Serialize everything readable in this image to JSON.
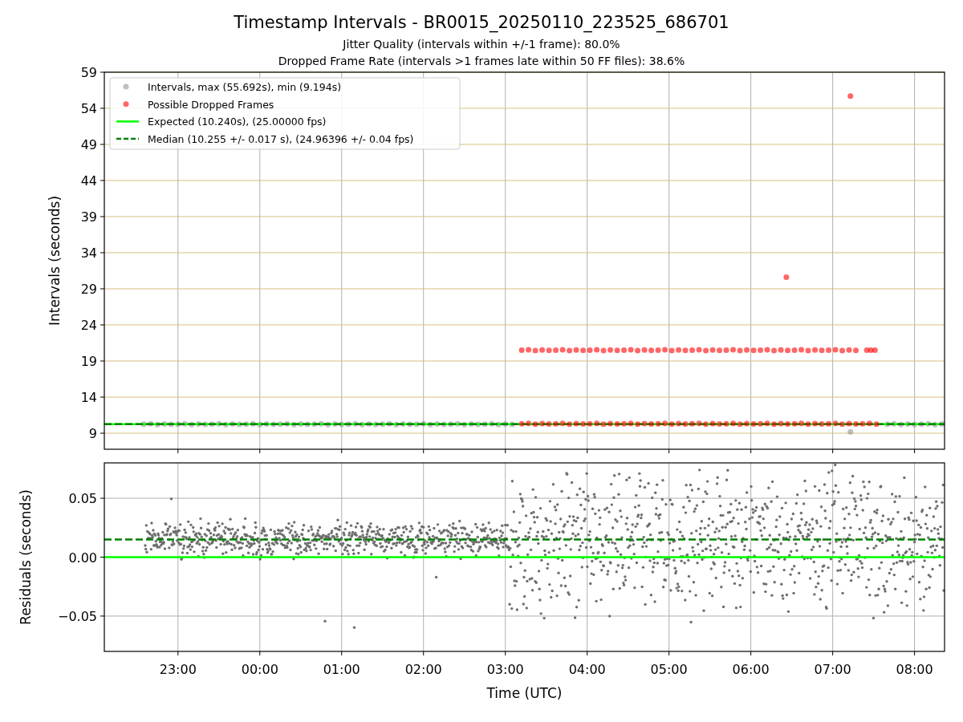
{
  "figure": {
    "title": "Timestamp Intervals - BR0015_20250110_223525_686701",
    "subtitles": [
      "Jitter Quality (intervals within +/-1 frame): 80.0%",
      "Dropped Frame Rate (intervals >1 frames late within 50 FF files): 38.6%"
    ]
  },
  "interval_plot": {
    "chart_data": {
      "type": "scatter",
      "grid": true,
      "legend": true,
      "ylabel": "Intervals (seconds)",
      "xlim": [
        "2025-01-10T22:06",
        "2025-01-11T08:22"
      ],
      "ylim": [
        6.78,
        59
      ],
      "yticks": [
        {
          "value": 59,
          "label": "59"
        },
        {
          "value": 54,
          "label": "54"
        },
        {
          "value": 49,
          "label": "49"
        },
        {
          "value": 44,
          "label": "44"
        },
        {
          "value": 39,
          "label": "39"
        },
        {
          "value": 34,
          "label": "34"
        },
        {
          "value": 29,
          "label": "29"
        },
        {
          "value": 24,
          "label": "24"
        },
        {
          "value": 19,
          "label": "19"
        },
        {
          "value": 14,
          "label": "14"
        },
        {
          "value": 9,
          "label": "9"
        }
      ],
      "series": [
        {
          "name": "Intervals, max (55.692s), min (9.194s)",
          "type": "scatter",
          "color": "#808080",
          "x": [
            "2025-01-10T22:35",
            "2025-01-10T22:40",
            "2025-01-10T22:45",
            "2025-01-10T22:50",
            "2025-01-10T22:55",
            "2025-01-10T23:00",
            "2025-01-10T23:05",
            "2025-01-10T23:10",
            "2025-01-10T23:15",
            "2025-01-10T23:20",
            "2025-01-10T23:25",
            "2025-01-10T23:30",
            "2025-01-10T23:35",
            "2025-01-10T23:40",
            "2025-01-10T23:45",
            "2025-01-10T23:50",
            "2025-01-10T23:55",
            "2025-01-11T00:00",
            "2025-01-11T00:05",
            "2025-01-11T00:10",
            "2025-01-11T00:15",
            "2025-01-11T00:20",
            "2025-01-11T00:25",
            "2025-01-11T00:30",
            "2025-01-11T00:35",
            "2025-01-11T00:40",
            "2025-01-11T00:45",
            "2025-01-11T00:50",
            "2025-01-11T00:55",
            "2025-01-11T01:00",
            "2025-01-11T01:05",
            "2025-01-11T01:10",
            "2025-01-11T01:15",
            "2025-01-11T01:20",
            "2025-01-11T01:25",
            "2025-01-11T01:30",
            "2025-01-11T01:35",
            "2025-01-11T01:40",
            "2025-01-11T01:45",
            "2025-01-11T01:50",
            "2025-01-11T01:55",
            "2025-01-11T02:00",
            "2025-01-11T02:05",
            "2025-01-11T02:10",
            "2025-01-11T02:15",
            "2025-01-11T02:20",
            "2025-01-11T02:25",
            "2025-01-11T02:30",
            "2025-01-11T02:35",
            "2025-01-11T02:40",
            "2025-01-11T02:45",
            "2025-01-11T02:50",
            "2025-01-11T02:55",
            "2025-01-11T03:00",
            "2025-01-11T03:05",
            "2025-01-11T07:40",
            "2025-01-11T07:45",
            "2025-01-11T07:50",
            "2025-01-11T07:55",
            "2025-01-11T08:00",
            "2025-01-11T08:05",
            "2025-01-11T08:10",
            "2025-01-11T08:15",
            "2025-01-11T08:20",
            "2025-01-11T07:13"
          ],
          "values": [
            10.25,
            10.31,
            10.2,
            10.28,
            10.22,
            10.25,
            10.31,
            10.2,
            10.28,
            10.22,
            10.25,
            10.31,
            10.2,
            10.28,
            10.22,
            10.25,
            10.31,
            10.2,
            10.28,
            10.22,
            10.25,
            10.31,
            10.2,
            10.28,
            10.22,
            10.25,
            10.31,
            10.2,
            10.28,
            10.22,
            10.25,
            10.31,
            10.2,
            10.28,
            10.22,
            10.25,
            10.31,
            10.2,
            10.28,
            10.22,
            10.25,
            10.31,
            10.2,
            10.28,
            10.22,
            10.25,
            10.31,
            10.2,
            10.28,
            10.22,
            10.25,
            10.31,
            10.2,
            10.28,
            10.22,
            10.25,
            10.31,
            10.2,
            10.28,
            10.22,
            10.25,
            10.31,
            10.2,
            10.28,
            9.194
          ]
        },
        {
          "name": "Possible Dropped Frames",
          "type": "scatter",
          "color": "#ff0000",
          "x": [
            "2025-01-11T03:12",
            "2025-01-11T03:17",
            "2025-01-11T03:22",
            "2025-01-11T03:27",
            "2025-01-11T03:32",
            "2025-01-11T03:37",
            "2025-01-11T03:42",
            "2025-01-11T03:47",
            "2025-01-11T03:52",
            "2025-01-11T03:57",
            "2025-01-11T04:02",
            "2025-01-11T04:07",
            "2025-01-11T04:12",
            "2025-01-11T04:17",
            "2025-01-11T04:22",
            "2025-01-11T04:27",
            "2025-01-11T04:32",
            "2025-01-11T04:37",
            "2025-01-11T04:42",
            "2025-01-11T04:47",
            "2025-01-11T04:52",
            "2025-01-11T04:57",
            "2025-01-11T05:02",
            "2025-01-11T05:07",
            "2025-01-11T05:12",
            "2025-01-11T05:17",
            "2025-01-11T05:22",
            "2025-01-11T05:27",
            "2025-01-11T05:32",
            "2025-01-11T05:37",
            "2025-01-11T05:42",
            "2025-01-11T05:47",
            "2025-01-11T05:52",
            "2025-01-11T05:57",
            "2025-01-11T06:02",
            "2025-01-11T06:07",
            "2025-01-11T06:12",
            "2025-01-11T06:17",
            "2025-01-11T06:22",
            "2025-01-11T06:27",
            "2025-01-11T06:32",
            "2025-01-11T06:37",
            "2025-01-11T06:42",
            "2025-01-11T06:47",
            "2025-01-11T06:52",
            "2025-01-11T06:57",
            "2025-01-11T07:02",
            "2025-01-11T07:07",
            "2025-01-11T07:12",
            "2025-01-11T07:17",
            "2025-01-11T07:22",
            "2025-01-11T07:27",
            "2025-01-11T07:32",
            "2025-01-11T03:12",
            "2025-01-11T03:17",
            "2025-01-11T03:22",
            "2025-01-11T03:27",
            "2025-01-11T03:32",
            "2025-01-11T03:37",
            "2025-01-11T03:42",
            "2025-01-11T03:47",
            "2025-01-11T03:52",
            "2025-01-11T03:57",
            "2025-01-11T04:02",
            "2025-01-11T04:07",
            "2025-01-11T04:12",
            "2025-01-11T04:17",
            "2025-01-11T04:22",
            "2025-01-11T04:27",
            "2025-01-11T04:32",
            "2025-01-11T04:37",
            "2025-01-11T04:42",
            "2025-01-11T04:47",
            "2025-01-11T04:52",
            "2025-01-11T04:57",
            "2025-01-11T05:02",
            "2025-01-11T05:07",
            "2025-01-11T05:12",
            "2025-01-11T05:17",
            "2025-01-11T05:22",
            "2025-01-11T05:27",
            "2025-01-11T05:32",
            "2025-01-11T05:37",
            "2025-01-11T05:42",
            "2025-01-11T05:47",
            "2025-01-11T05:52",
            "2025-01-11T05:57",
            "2025-01-11T06:02",
            "2025-01-11T06:07",
            "2025-01-11T06:12",
            "2025-01-11T06:17",
            "2025-01-11T06:22",
            "2025-01-11T06:27",
            "2025-01-11T06:32",
            "2025-01-11T06:37",
            "2025-01-11T06:42",
            "2025-01-11T06:47",
            "2025-01-11T06:52",
            "2025-01-11T06:57",
            "2025-01-11T07:02",
            "2025-01-11T07:07",
            "2025-01-11T07:12",
            "2025-01-11T07:17",
            "2025-01-11T07:25",
            "2025-01-11T07:28",
            "2025-01-11T07:31",
            "2025-01-11T06:26",
            "2025-01-11T07:13"
          ],
          "values": [
            10.3,
            10.36,
            10.25,
            10.33,
            10.27,
            10.3,
            10.36,
            10.25,
            10.33,
            10.27,
            10.3,
            10.36,
            10.25,
            10.33,
            10.27,
            10.3,
            10.36,
            10.25,
            10.33,
            10.27,
            10.3,
            10.36,
            10.25,
            10.33,
            10.27,
            10.3,
            10.36,
            10.25,
            10.33,
            10.27,
            10.3,
            10.36,
            10.25,
            10.33,
            10.27,
            10.3,
            10.36,
            10.25,
            10.33,
            10.27,
            10.3,
            10.36,
            10.25,
            10.33,
            10.27,
            10.3,
            10.36,
            10.25,
            10.33,
            10.27,
            10.3,
            10.36,
            10.25,
            20.5,
            20.56,
            20.44,
            20.52,
            20.47,
            20.5,
            20.56,
            20.44,
            20.52,
            20.47,
            20.5,
            20.56,
            20.44,
            20.52,
            20.47,
            20.5,
            20.56,
            20.44,
            20.52,
            20.47,
            20.5,
            20.56,
            20.44,
            20.52,
            20.47,
            20.5,
            20.56,
            20.44,
            20.52,
            20.47,
            20.5,
            20.56,
            20.44,
            20.52,
            20.47,
            20.5,
            20.56,
            20.44,
            20.52,
            20.47,
            20.5,
            20.56,
            20.44,
            20.52,
            20.47,
            20.5,
            20.56,
            20.44,
            20.52,
            20.47,
            20.5,
            20.5,
            20.5,
            30.6,
            55.692
          ]
        },
        {
          "name": "Expected (10.240s), (25.00000 fps)",
          "type": "line",
          "color": "#00ff00",
          "x": [
            "2025-01-10T22:06",
            "2025-01-11T08:22"
          ],
          "values": [
            10.24,
            10.24
          ]
        },
        {
          "name": "Median (10.255 +/- 0.017 s), (24.96396 +/- 0.04 fps)",
          "type": "line",
          "line_style": "dashed",
          "color": "#008000",
          "x": [
            "2025-01-10T22:06",
            "2025-01-11T08:22"
          ],
          "values": [
            10.255,
            10.255
          ]
        }
      ]
    }
  },
  "residual_plot": {
    "chart_data": {
      "type": "scatter",
      "grid": true,
      "xlabel": "Time (UTC)",
      "ylabel": "Residuals (seconds)",
      "xlim": [
        "2025-01-10T22:06",
        "2025-01-11T08:22"
      ],
      "ylim": [
        -0.08,
        0.08
      ],
      "xticks": [
        {
          "value": "2025-01-10T23:00",
          "label": "23:00"
        },
        {
          "value": "2025-01-11T00:00",
          "label": "00:00"
        },
        {
          "value": "2025-01-11T01:00",
          "label": "01:00"
        },
        {
          "value": "2025-01-11T02:00",
          "label": "02:00"
        },
        {
          "value": "2025-01-11T03:00",
          "label": "03:00"
        },
        {
          "value": "2025-01-11T04:00",
          "label": "04:00"
        },
        {
          "value": "2025-01-11T05:00",
          "label": "05:00"
        },
        {
          "value": "2025-01-11T06:00",
          "label": "06:00"
        },
        {
          "value": "2025-01-11T07:00",
          "label": "07:00"
        },
        {
          "value": "2025-01-11T08:00",
          "label": "08:00"
        }
      ],
      "yticks": [
        {
          "value": 0.05,
          "label": "0.05"
        },
        {
          "value": 0,
          "label": "0.00"
        },
        {
          "value": -0.05,
          "label": "−0.05"
        }
      ],
      "series": [
        {
          "type": "line",
          "line_style": "dashed",
          "color": "#008000",
          "x": [
            "2025-01-10T22:06",
            "2025-01-11T08:22"
          ],
          "values": [
            0.015,
            0.015
          ]
        },
        {
          "type": "line",
          "color": "#00ff00",
          "x": [
            "2025-01-10T22:06",
            "2025-01-11T08:22"
          ],
          "values": [
            0,
            0
          ]
        }
      ]
    }
  }
}
